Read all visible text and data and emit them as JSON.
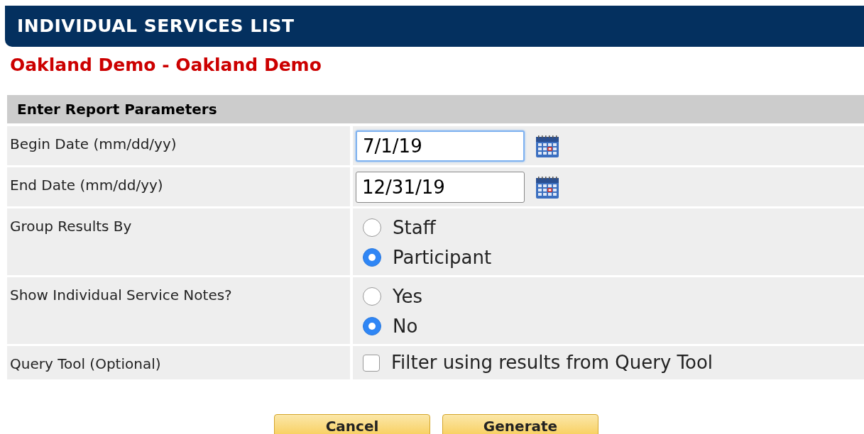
{
  "header": {
    "title": "INDIVIDUAL SERVICES LIST"
  },
  "subtitle": "Oakland Demo - Oakland Demo",
  "section": {
    "title": "Enter Report Parameters"
  },
  "rows": [
    {
      "kind": "date",
      "label": "Begin Date (mm/dd/yy)",
      "value": "7/1/19",
      "focused": true
    },
    {
      "kind": "date",
      "label": "End Date (mm/dd/yy)",
      "value": "12/31/19",
      "focused": false
    },
    {
      "kind": "radio",
      "label": "Group Results By",
      "options": [
        {
          "label": "Staff",
          "selected": false
        },
        {
          "label": "Participant",
          "selected": true
        }
      ]
    },
    {
      "kind": "radio",
      "label": "Show Individual Service Notes?",
      "options": [
        {
          "label": "Yes",
          "selected": false
        },
        {
          "label": "No",
          "selected": true
        }
      ]
    },
    {
      "kind": "checkbox",
      "label": "Query Tool (Optional)",
      "option": {
        "label": "Filter using results from Query Tool",
        "checked": false
      }
    }
  ],
  "buttons": [
    "Cancel",
    "Generate"
  ]
}
